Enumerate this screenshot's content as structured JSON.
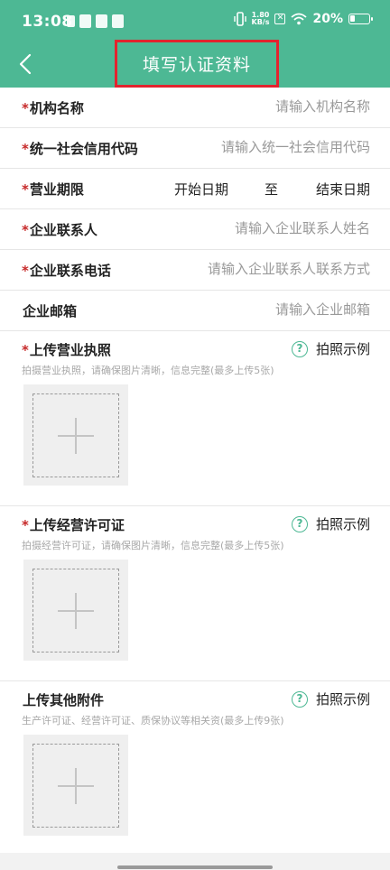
{
  "status_bar": {
    "time": "13:08",
    "net_speed_value": "1.80",
    "net_speed_unit": "KB/s",
    "battery": "20%"
  },
  "header": {
    "title": "填写认证资料",
    "color": "#4db894",
    "highlight_color": "#e3232e"
  },
  "fields": [
    {
      "label": "机构名称",
      "required": "*",
      "placeholder": "请输入机构名称"
    },
    {
      "label": "统一社会信用代码",
      "required": "*",
      "placeholder": "请输入统一社会信用代码"
    },
    {
      "label": "营业期限",
      "required": "*",
      "start": "开始日期",
      "to": "至",
      "end": "结束日期"
    },
    {
      "label": "企业联系人",
      "required": "*",
      "placeholder": "请输入企业联系人姓名"
    },
    {
      "label": "企业联系电话",
      "required": "*",
      "placeholder": "请输入企业联系人联系方式"
    },
    {
      "label": "企业邮箱",
      "required": "",
      "placeholder": "请输入企业邮箱"
    }
  ],
  "uploads": [
    {
      "title": "上传营业执照",
      "required": "*",
      "hint": "拍摄营业执照，请确保图片清晰，信息完整(最多上传5张)",
      "example": "拍照示例"
    },
    {
      "title": "上传经营许可证",
      "required": "*",
      "hint": "拍摄经营许可证，请确保图片清晰，信息完整(最多上传5张)",
      "example": "拍照示例"
    },
    {
      "title": "上传其他附件",
      "required": "",
      "hint": "生产许可证、经营许可证、质保协议等相关资(最多上传9张)",
      "example": "拍照示例"
    }
  ],
  "icons": {
    "back": "chevron-left-icon",
    "help": "question-circle-icon",
    "add": "plus-icon"
  }
}
